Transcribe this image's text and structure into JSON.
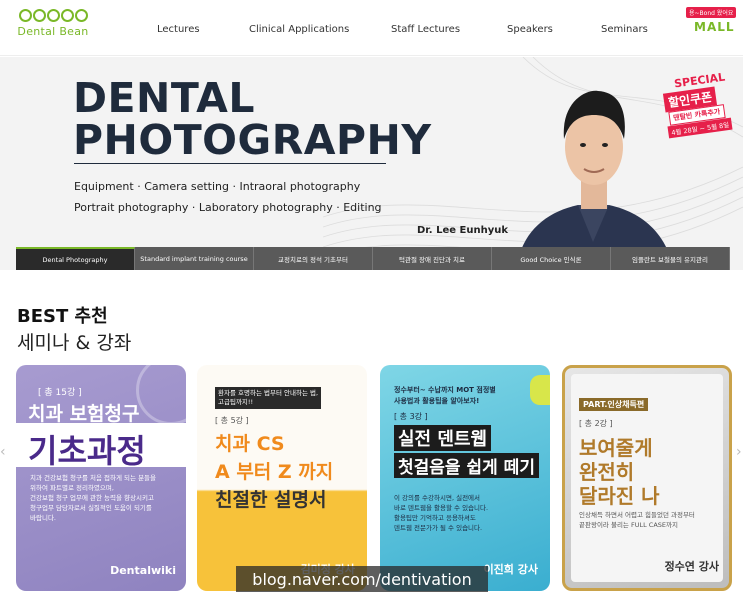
{
  "header": {
    "logo_text": "Dental Bean",
    "nav": [
      "Lectures",
      "Clinical Applications",
      "Staff Lectures",
      "Speakers",
      "Seminars"
    ],
    "mall_badge": "용~Bond 왔어요",
    "mall_label": "MALL"
  },
  "hero": {
    "title_line1": "DENTAL",
    "title_line2": "PHOTOGRAPHY",
    "subtitle_line1": "Equipment · Camera setting · Intraoral photography",
    "subtitle_line2": "Portrait photography · Laboratory photography · Editing",
    "doctor": "Dr. Lee Eunhyuk",
    "promo": {
      "special": "SPECIAL",
      "coupon": "할인쿠폰",
      "sub": "덴탈빈 카톡추가",
      "date": "4월 28일 ~ 5월 8일"
    }
  },
  "tabs": [
    "Dental Photography",
    "Standard implant training course",
    "교정치료의 정석 기초부터",
    "턱관절 장애 진단과 치료",
    "Good Choice 인식론",
    "임플란트 보철물의 유지관리"
  ],
  "best": {
    "title": "BEST 추천",
    "subtitle": "세미나 & 강좌"
  },
  "cards": [
    {
      "count": "[ 총 15강 ]",
      "line1": "치과 보험청구",
      "big": "기초과정",
      "desc": [
        "치과 건강보험 청구를 처음 접하게 되는 분들을",
        "위하여 파트별로 정리하였으며,",
        "건강보험 청구 업무에 관한 능력을 향상시키고",
        "청구업무 담당자로서 실질적인 도움이 되기를",
        "바랍니다."
      ],
      "author": "Dentalwiki"
    },
    {
      "tag": "환자를 호명하는 법부터 안내하는 법,",
      "tag2": "고급팁까지!!",
      "count": "[ 총 5강 ]",
      "line1": "치과 CS",
      "line2": "A 부터 Z 까지",
      "line3": "친절한 설명서",
      "author": "김미정 강사"
    },
    {
      "intro1": "정수부터~ 수납까지 MOT 점정별",
      "intro2": "사용법과 활용팁을 알아보자!",
      "count": "[ 총 3강 ]",
      "line1": "실전 덴트웹",
      "line2": "첫걸음을 쉽게 떼기",
      "desc": [
        "이 강의를 수강하시면, 실전에서",
        "바로 덴트웹을 활용할 수 있습니다.",
        "활용팁만 기억하고 응용하셔도",
        "덴트웹 전문가가 될 수 있습니다."
      ],
      "author": "이진희 강사"
    },
    {
      "tag": "PART.인상채득편",
      "count": "[ 총 2강 ]",
      "line1": "보여줄게",
      "line2": "완전히",
      "line3": "달라진 나",
      "desc": [
        "인상채득 하면서 어렵고 힘들었던 과정부터",
        "끝판왕이라 불리는 FULL CASE까지"
      ],
      "author": "정수연 강사"
    }
  ],
  "watermark": "blog.naver.com/dentivation"
}
